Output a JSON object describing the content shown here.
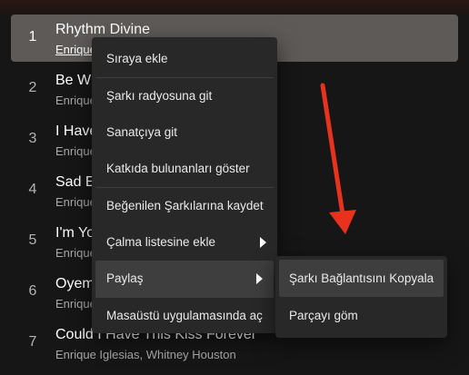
{
  "tracks": [
    {
      "num": "1",
      "title": "Rhythm Divine",
      "artist": "Enrique Iglesias"
    },
    {
      "num": "2",
      "title": "Be With You",
      "artist": "Enrique Iglesias"
    },
    {
      "num": "3",
      "title": "I Have Always Loved You",
      "artist": "Enrique Iglesias"
    },
    {
      "num": "4",
      "title": "Sad Eyes",
      "artist": "Enrique Iglesias"
    },
    {
      "num": "5",
      "title": "I'm Your Man",
      "artist": "Enrique Iglesias"
    },
    {
      "num": "6",
      "title": "Oyeme",
      "artist": "Enrique Iglesias"
    },
    {
      "num": "7",
      "title": "Could I Have This Kiss Forever",
      "artist": "Enrique Iglesias, Whitney Houston"
    }
  ],
  "context_menu": {
    "add_to_queue": "Sıraya ekle",
    "go_to_song_radio": "Şarkı radyosuna git",
    "go_to_artist": "Sanatçıya git",
    "show_credits": "Katkıda bulunanları göster",
    "save_to_liked": "Beğenilen Şarkılarına kaydet",
    "add_to_playlist": "Çalma listesine ekle",
    "share": "Paylaş",
    "open_in_desktop": "Masaüstü uygulamasında aç"
  },
  "share_submenu": {
    "copy_song_link": "Şarkı Bağlantısını Kopyala",
    "embed_track": "Parçayı göm"
  },
  "annotation": {
    "arrow_color": "#e8321e"
  }
}
